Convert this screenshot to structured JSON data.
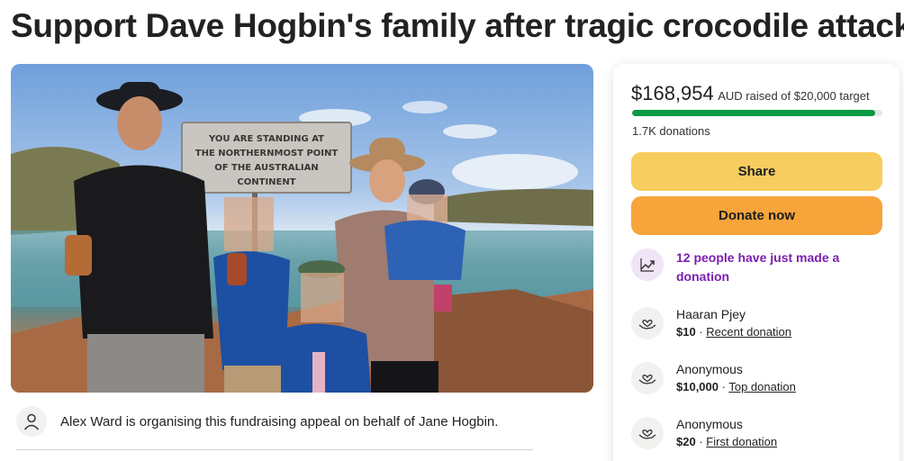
{
  "page": {
    "title": "Support Dave Hogbin's family after tragic crocodile attack"
  },
  "photo": {
    "sign_text": [
      "YOU ARE STANDING AT",
      "THE NORTHERNMOST POINT",
      "OF THE AUSTRALIAN",
      "CONTINENT"
    ]
  },
  "organiser": {
    "icon": "person-icon",
    "text": "Alex Ward is organising this fundraising appeal on behalf of Jane Hogbin."
  },
  "card": {
    "raised_amount": "$168,954",
    "raised_text": "AUD raised of $20,000 target",
    "progress_fraction": 1.0,
    "donation_count": "1.7K donations",
    "share_label": "Share",
    "donate_label": "Donate now",
    "trend_icon": "trending-up-icon",
    "trend_text": "12 people have just made a donation",
    "donations": [
      {
        "name": "Haaran Pjey",
        "amount": "$10",
        "sep": "·",
        "tag": "Recent donation",
        "icon": "heart-hands-icon"
      },
      {
        "name": "Anonymous",
        "amount": "$10,000",
        "sep": "·",
        "tag": "Top donation",
        "icon": "heart-hands-icon"
      },
      {
        "name": "Anonymous",
        "amount": "$20",
        "sep": "·",
        "tag": "First donation",
        "icon": "heart-hands-icon"
      }
    ]
  },
  "colors": {
    "share": "#f6cd5e",
    "donate": "#f7a43b",
    "progress": "#0a9a45",
    "trend": "#7a1fb0"
  }
}
